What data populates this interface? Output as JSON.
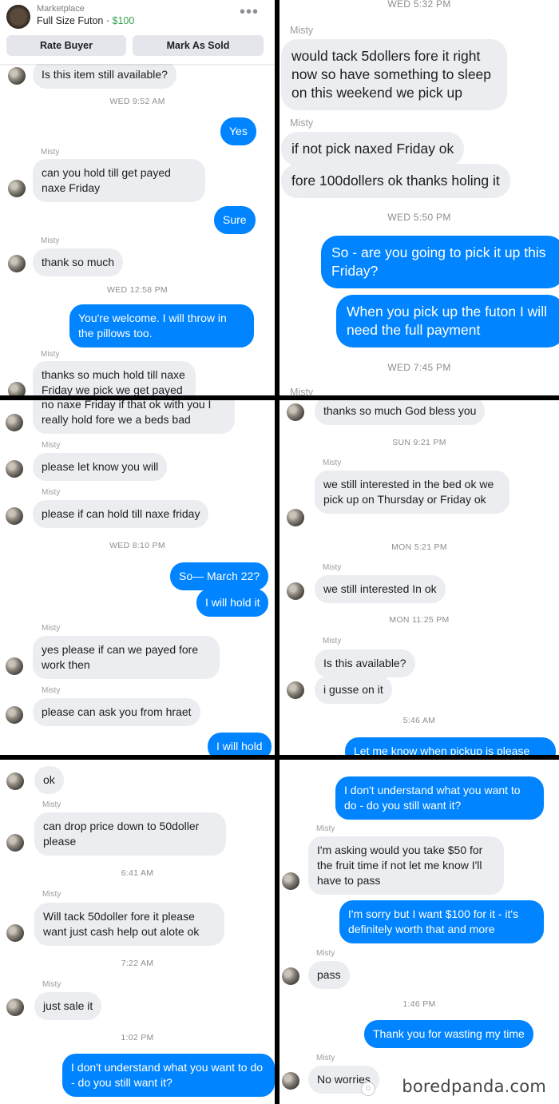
{
  "p1": {
    "header": {
      "subtitle": "Marketplace",
      "title": "Full Size Futon ·",
      "price": "$100",
      "more": "•••",
      "rate_buyer": "Rate Buyer",
      "mark_as_sold": "Mark As Sold"
    },
    "m1": "Is this item still available?",
    "ts1": "WED 9:52 AM",
    "m2": "Yes",
    "n1": "Misty",
    "m3": "can you hold till get payed naxe Friday",
    "m4": "Sure",
    "n2": "Misty",
    "m5": "thank so much",
    "ts2": "WED 12:58 PM",
    "m6": "You're welcome. I will throw in the pillows too.",
    "n3": "Misty",
    "m7": "thanks  so much hold till naxe Friday we pick we get payed"
  },
  "p2": {
    "ts0": "WED 5:32 PM",
    "n1": "Misty",
    "m1": "would tack 5dollers fore it right now so have something to sleep on this weekend we pick up",
    "n2": "Misty",
    "m2": "if not pick naxed Friday ok",
    "m3": "fore 100dollers ok thanks holing it",
    "ts1": "WED 5:50 PM",
    "m4": "So - are you going to pick it up this Friday?",
    "m5": "When you pick up the futon I will need the full payment",
    "ts2": "WED 7:45 PM",
    "n3": "Misty"
  },
  "p3": {
    "m1": "no  naxe Friday if  that ok with you I really hold fore we a beds bad",
    "n1": "Misty",
    "m2": "please let know you will",
    "n2": "Misty",
    "m3": "please if can hold till naxe friday",
    "ts1": "WED 8:10 PM",
    "m4": "So— March 22?",
    "m5": "I will hold it",
    "n3": "Misty",
    "m6": "yes please if can we payed fore work then",
    "n4": "Misty",
    "m7": "please can ask you  from hraet",
    "m8": "I will hold"
  },
  "p4": {
    "m1": "thanks so much  God bless you",
    "ts1": "SUN 9:21 PM",
    "n1": "Misty",
    "m2": "we still interested  in the bed ok we pick up on Thursday or Friday ok",
    "ts2": "MON 5:21 PM",
    "n2": "Misty",
    "m3": "we still interested In ok",
    "ts3": "MON 11:25 PM",
    "n3": "Misty",
    "m4": "Is this available?",
    "m5": "i gusse on it",
    "ts4": "5:46 AM",
    "m6": "Let me know when pickup is please"
  },
  "p5": {
    "m1": "ok",
    "n1": "Misty",
    "m2": "can drop price down to 50doller please",
    "ts1": "6:41 AM",
    "n2": "Misty",
    "m3": "Will tack 50doller fore it please want just cash help out alote ok",
    "ts2": "7:22 AM",
    "n3": "Misty",
    "m4": "just sale it",
    "ts3": "1:02 PM",
    "m5": "I don't understand what you want to do - do you still want it?"
  },
  "p6": {
    "m1": "I don't understand what you want to do - do you still want it?",
    "n1": "Misty",
    "m2": "I'm asking would you take $50 for the fruit time if not let me know I'll have to pass",
    "m3": "I'm sorry but I want $100 for it - it's definitely worth that and more",
    "n2": "Misty",
    "m4": "pass",
    "ts1": "1:46 PM",
    "m5": "Thank you for wasting my time",
    "n3": "Misty",
    "m6": "No worries"
  },
  "watermark": {
    "name": "boredpanda",
    "dot": ".",
    "tld": "com"
  },
  "colors": {
    "outgoing": "#0084ff",
    "incoming": "#ebedf0",
    "price": "#31a24c"
  }
}
